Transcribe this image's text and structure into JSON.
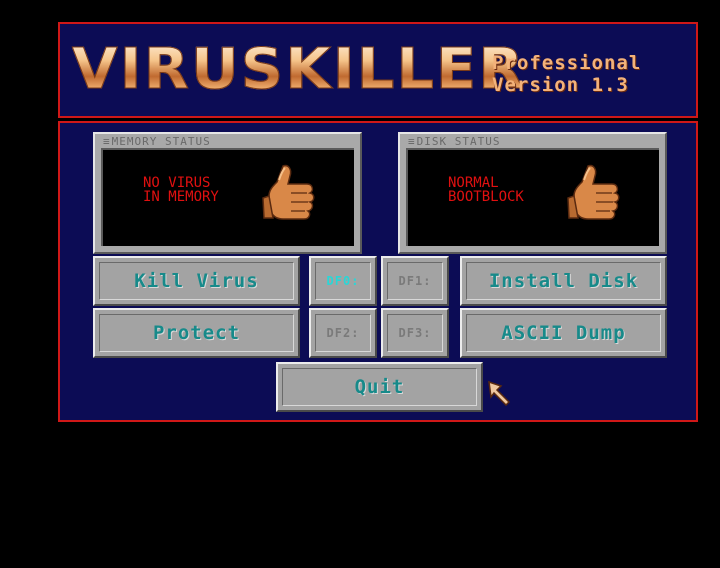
{
  "app": {
    "logo_text": "VIRUSKILLER",
    "edition_line1": "Professional",
    "edition_line2": "Version 1.3"
  },
  "memory_status": {
    "title": "MEMORY STATUS",
    "message": "NO VIRUS\nIN MEMORY"
  },
  "disk_status": {
    "title": "DISK STATUS",
    "message": "NORMAL\nBOOTBLOCK"
  },
  "buttons": {
    "kill_virus": "Kill Virus",
    "protect": "Protect",
    "install_disk": "Install Disk",
    "ascii_dump": "ASCII Dump",
    "quit": "Quit"
  },
  "drives": {
    "df0": "DF0:",
    "df1": "DF1:",
    "df2": "DF2:",
    "df3": "DF3:",
    "selected": "DF0:"
  },
  "colors": {
    "background": "#000000",
    "panel_bg": "#0c0c55",
    "frame_border": "#d01818",
    "button_text": "#178a8a",
    "selected_drive_text": "#2ad6d6",
    "status_text": "#e01010"
  },
  "icons": {
    "status_ok": "thumbs-up-icon",
    "pointer": "mouse-pointer-icon"
  }
}
